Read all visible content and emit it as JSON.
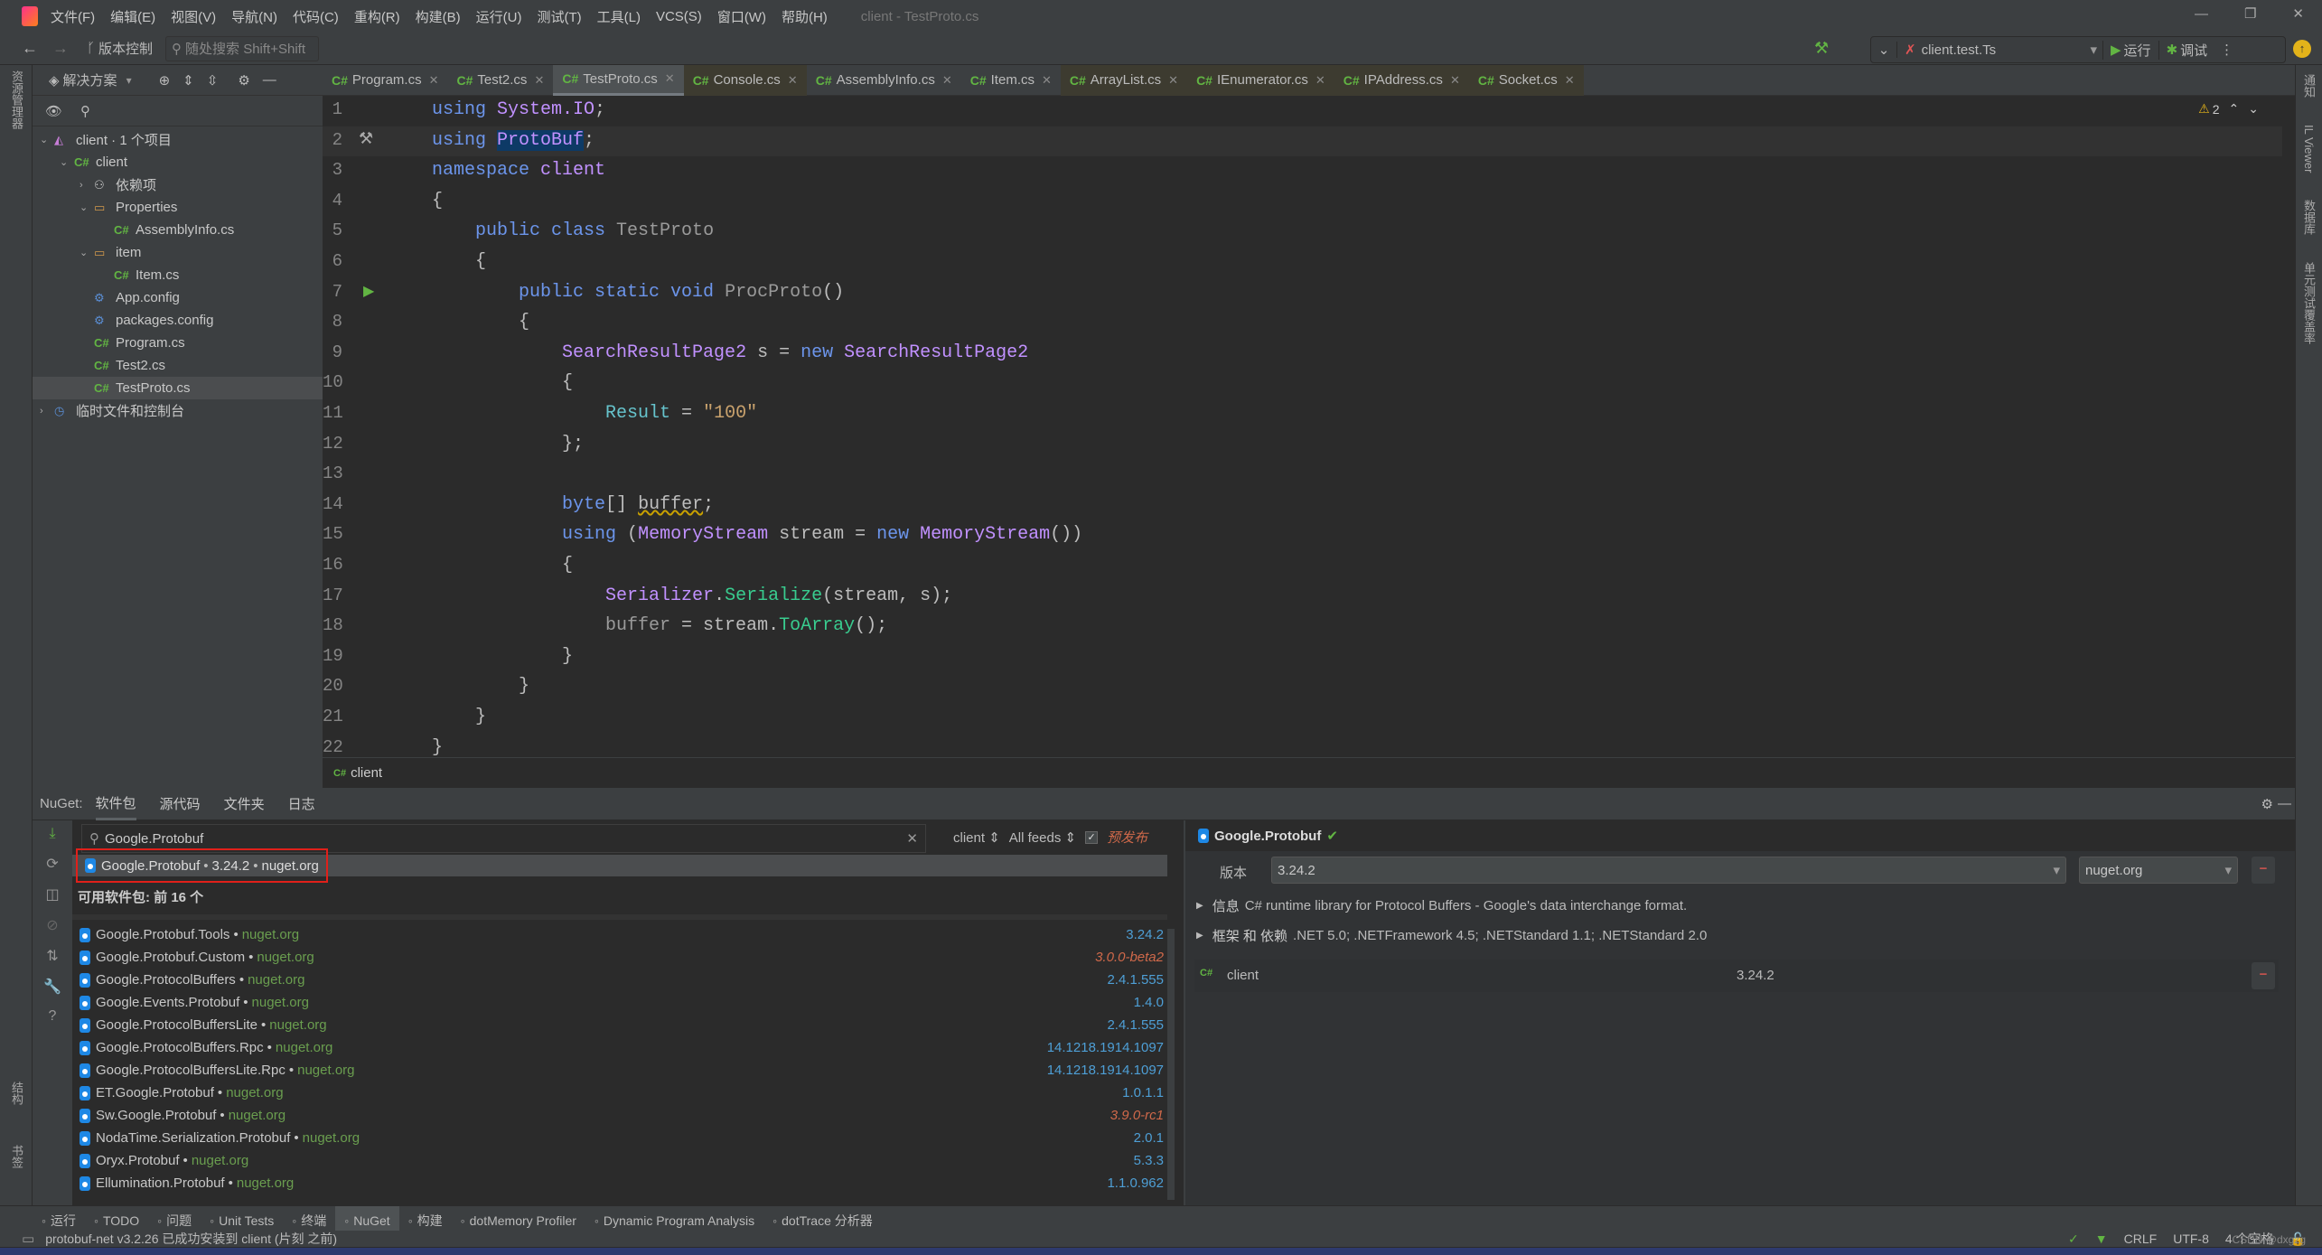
{
  "titlebar": {
    "menu": [
      "文件(F)",
      "编辑(E)",
      "视图(V)",
      "导航(N)",
      "代码(C)",
      "重构(R)",
      "构建(B)",
      "运行(U)",
      "测试(T)",
      "工具(L)",
      "VCS(S)",
      "窗口(W)",
      "帮助(H)"
    ],
    "title": "client - TestProto.cs"
  },
  "toolbar": {
    "vcs_label": "版本控制",
    "search_placeholder": "随处搜索 Shift+Shift",
    "run_config": "client.test.Ts",
    "run_label": "运行",
    "debug_label": "调试"
  },
  "tabs": [
    {
      "label": "Program.cs",
      "olive": false,
      "active": false
    },
    {
      "label": "Test2.cs",
      "olive": false,
      "active": false
    },
    {
      "label": "TestProto.cs",
      "olive": false,
      "active": true
    },
    {
      "label": "Console.cs",
      "olive": true,
      "active": false
    },
    {
      "label": "AssemblyInfo.cs",
      "olive": false,
      "active": false
    },
    {
      "label": "Item.cs",
      "olive": false,
      "active": false
    },
    {
      "label": "ArrayList.cs",
      "olive": true,
      "active": false
    },
    {
      "label": "IEnumerator.cs",
      "olive": true,
      "active": false
    },
    {
      "label": "IPAddress.cs",
      "olive": true,
      "active": false
    },
    {
      "label": "Socket.cs",
      "olive": true,
      "active": false
    }
  ],
  "project": {
    "header": "解决方案",
    "tree": [
      {
        "label": "client · 1 个项目",
        "depth": 0,
        "arrow": "down",
        "icon": "solution"
      },
      {
        "label": "client",
        "depth": 1,
        "arrow": "down",
        "icon": "csproj"
      },
      {
        "label": "依赖项",
        "depth": 2,
        "arrow": "right",
        "icon": "dependencies"
      },
      {
        "label": "Properties",
        "depth": 2,
        "arrow": "down",
        "icon": "folder"
      },
      {
        "label": "AssemblyInfo.cs",
        "depth": 3,
        "arrow": "",
        "icon": "cs"
      },
      {
        "label": "item",
        "depth": 2,
        "arrow": "down",
        "icon": "folder"
      },
      {
        "label": "Item.cs",
        "depth": 3,
        "arrow": "",
        "icon": "cs"
      },
      {
        "label": "App.config",
        "depth": 2,
        "arrow": "",
        "icon": "config"
      },
      {
        "label": "packages.config",
        "depth": 2,
        "arrow": "",
        "icon": "config"
      },
      {
        "label": "Program.cs",
        "depth": 2,
        "arrow": "",
        "icon": "cs"
      },
      {
        "label": "Test2.cs",
        "depth": 2,
        "arrow": "",
        "icon": "cs"
      },
      {
        "label": "TestProto.cs",
        "depth": 2,
        "arrow": "",
        "icon": "cs",
        "selected": true
      },
      {
        "label": "临时文件和控制台",
        "depth": 0,
        "arrow": "right",
        "icon": "scratch"
      }
    ]
  },
  "left_strip": {
    "top": "资源管理器",
    "bottom1": "结构",
    "bottom2": "书签"
  },
  "right_strip": {
    "labels": [
      "通知",
      "IL Viewer",
      "数据库",
      "单元测试覆盖率"
    ]
  },
  "editor": {
    "warnings": "2",
    "breadcrumb": "client",
    "lines": [
      [
        [
          "using ",
          "kw"
        ],
        [
          "System.IO",
          "ty"
        ],
        [
          ";",
          "pl"
        ]
      ],
      [
        [
          "using ",
          "kw"
        ],
        [
          "ProtoBuf",
          "ty sel"
        ],
        [
          ";",
          "pl"
        ]
      ],
      [
        [
          "namespace ",
          "kw"
        ],
        [
          "client",
          "ty"
        ]
      ],
      [
        [
          "{",
          "pl"
        ]
      ],
      [
        [
          "    public class ",
          "kw"
        ],
        [
          "TestProto",
          "dim"
        ]
      ],
      [
        [
          "    {",
          "pl"
        ]
      ],
      [
        [
          "        public static void ",
          "kw"
        ],
        [
          "ProcProto",
          "dim"
        ],
        [
          "()",
          "pl"
        ]
      ],
      [
        [
          "        {",
          "pl"
        ]
      ],
      [
        [
          "            ",
          "pl"
        ],
        [
          "SearchResultPage2",
          "ty"
        ],
        [
          " s = ",
          "pl"
        ],
        [
          "new ",
          "kw"
        ],
        [
          "SearchResultPage2",
          "ty"
        ]
      ],
      [
        [
          "            {",
          "pl"
        ]
      ],
      [
        [
          "                ",
          "pl"
        ],
        [
          "Result",
          "prop"
        ],
        [
          " = ",
          "pl"
        ],
        [
          "\"100\"",
          "str"
        ]
      ],
      [
        [
          "            };",
          "pl"
        ]
      ],
      [
        [
          "",
          "pl"
        ]
      ],
      [
        [
          "            ",
          "pl"
        ],
        [
          "byte",
          "kw"
        ],
        [
          "[] ",
          "pl"
        ],
        [
          "buffer",
          "pl wave"
        ],
        [
          ";",
          "pl"
        ]
      ],
      [
        [
          "            ",
          "pl"
        ],
        [
          "using ",
          "kw"
        ],
        [
          "(",
          "pl"
        ],
        [
          "MemoryStream",
          "ty"
        ],
        [
          " stream = ",
          "pl"
        ],
        [
          "new ",
          "kw"
        ],
        [
          "MemoryStream",
          "ty"
        ],
        [
          "())",
          "pl"
        ]
      ],
      [
        [
          "            {",
          "pl"
        ]
      ],
      [
        [
          "                ",
          "pl"
        ],
        [
          "Serializer",
          "ty"
        ],
        [
          ".",
          "pl"
        ],
        [
          "Serialize",
          "fn"
        ],
        [
          "(stream, s);",
          "pl"
        ]
      ],
      [
        [
          "                ",
          "pl"
        ],
        [
          "buffer",
          "dim"
        ],
        [
          " = stream.",
          "pl"
        ],
        [
          "ToArray",
          "fn"
        ],
        [
          "();",
          "pl"
        ]
      ],
      [
        [
          "            }",
          "pl"
        ]
      ],
      [
        [
          "        }",
          "pl"
        ]
      ],
      [
        [
          "    }",
          "pl"
        ]
      ],
      [
        [
          "}",
          "pl"
        ]
      ]
    ]
  },
  "nuget": {
    "label": "NuGet:",
    "tabs": [
      "软件包",
      "源代码",
      "文件夹",
      "日志"
    ],
    "search_value": "Google.Protobuf",
    "project_filter": "client",
    "feed_filter": "All feeds",
    "prerelease_label": "预发布",
    "prerelease_checked": true,
    "installed": {
      "name": "Google.Protobuf",
      "version": "3.24.2",
      "source": "nuget.org"
    },
    "available_header": "可用软件包: 前 16 个",
    "packages": [
      {
        "name": "Google.Protobuf.Tools",
        "source": "nuget.org",
        "version": "3.24.2",
        "pre": false
      },
      {
        "name": "Google.Protobuf.Custom",
        "source": "nuget.org",
        "version": "3.0.0-beta2",
        "pre": true
      },
      {
        "name": "Google.ProtocolBuffers",
        "source": "nuget.org",
        "version": "2.4.1.555",
        "pre": false
      },
      {
        "name": "Google.Events.Protobuf",
        "source": "nuget.org",
        "version": "1.4.0",
        "pre": false
      },
      {
        "name": "Google.ProtocolBuffersLite",
        "source": "nuget.org",
        "version": "2.4.1.555",
        "pre": false
      },
      {
        "name": "Google.ProtocolBuffers.Rpc",
        "source": "nuget.org",
        "version": "14.1218.1914.1097",
        "pre": false
      },
      {
        "name": "Google.ProtocolBuffersLite.Rpc",
        "source": "nuget.org",
        "version": "14.1218.1914.1097",
        "pre": false
      },
      {
        "name": "ET.Google.Protobuf",
        "source": "nuget.org",
        "version": "1.0.1.1",
        "pre": false
      },
      {
        "name": "Sw.Google.Protobuf",
        "source": "nuget.org",
        "version": "3.9.0-rc1",
        "pre": true
      },
      {
        "name": "NodaTime.Serialization.Protobuf",
        "source": "nuget.org",
        "version": "2.0.1",
        "pre": false
      },
      {
        "name": "Oryx.Protobuf",
        "source": "nuget.org",
        "version": "5.3.3",
        "pre": false
      },
      {
        "name": "Ellumination.Protobuf",
        "source": "nuget.org",
        "version": "1.1.0.962",
        "pre": false
      }
    ],
    "detail": {
      "name": "Google.Protobuf",
      "version_label": "版本",
      "version": "3.24.2",
      "source": "nuget.org",
      "info_label": "信息",
      "info": "C# runtime library for Protocol Buffers - Google's data interchange format.",
      "frameworks_label": "框架 和 依赖",
      "frameworks": ".NET 5.0; .NETFramework 4.5; .NETStandard 1.1; .NETStandard 2.0",
      "project": "client",
      "project_version": "3.24.2"
    }
  },
  "bottom_tabs": [
    {
      "label": "运行",
      "icon": "play-icon"
    },
    {
      "label": "TODO",
      "icon": "list-icon"
    },
    {
      "label": "问题",
      "icon": "problems-icon"
    },
    {
      "label": "Unit Tests",
      "icon": "unit-tests-icon"
    },
    {
      "label": "终端",
      "icon": "terminal-icon"
    },
    {
      "label": "NuGet",
      "icon": "nuget-icon",
      "active": true
    },
    {
      "label": "构建",
      "icon": "hammer-icon"
    },
    {
      "label": "dotMemory Profiler",
      "icon": "dotmemory-icon"
    },
    {
      "label": "Dynamic Program Analysis",
      "icon": "dpa-icon"
    },
    {
      "label": "dotTrace 分析器",
      "icon": "dottrace-icon"
    }
  ],
  "status": {
    "message": "protobuf-net v3.2.26 已成功安装到 client (片刻 之前)",
    "line_ending": "CRLF",
    "encoding": "UTF-8",
    "indent": "4 个空格",
    "watermark": "CSDN @dxgzg"
  },
  "colors": {
    "accent": "#4e9fd6",
    "prerelease": "#d0694a",
    "highlight_box": "#e0201a",
    "success": "#62b543"
  }
}
